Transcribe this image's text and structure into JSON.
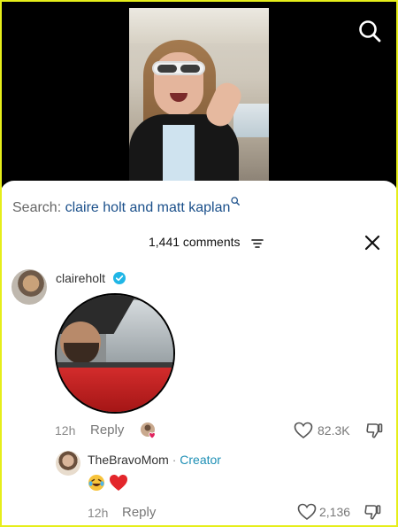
{
  "search": {
    "prefix": "Search:",
    "query": "claire holt and matt kaplan"
  },
  "comments_header": {
    "count_label": "1,441 comments"
  },
  "comments": [
    {
      "username": "claireholt",
      "verified": true,
      "time": "12h",
      "reply_label": "Reply",
      "likes": "82.3K"
    }
  ],
  "replies": [
    {
      "username": "TheBravoMom",
      "separator": "·",
      "badge": "Creator",
      "emojis": [
        "laughing-tears",
        "red-heart"
      ],
      "time": "12h",
      "reply_label": "Reply",
      "likes": "2,136"
    }
  ],
  "colors": {
    "frame": "#e6ee1a",
    "link": "#1a4f8a",
    "verified": "#20b6e6",
    "creator": "#1d8fb5",
    "heart": "#e0245e"
  }
}
